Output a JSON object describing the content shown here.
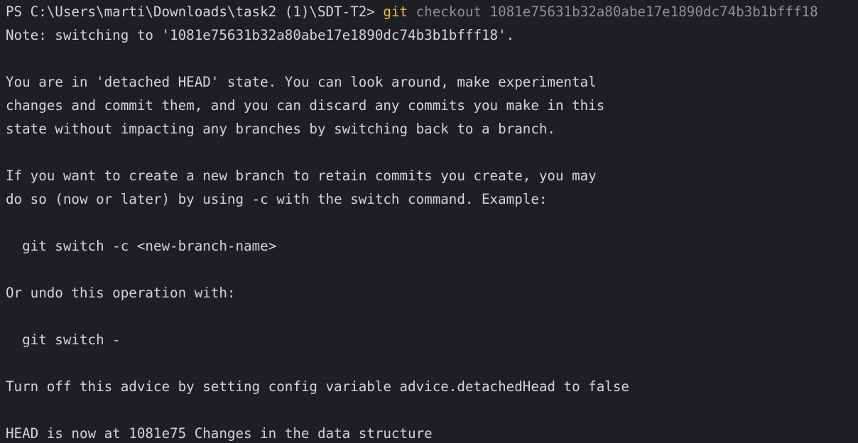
{
  "terminal": {
    "prompt": "PS C:\\Users\\marti\\Downloads\\task2 (1)\\SDT-T2> ",
    "command": "git",
    "args": " checkout 1081e75631b32a80abe17e1890dc74b3b1bfff18",
    "output": [
      "Note: switching to '1081e75631b32a80abe17e1890dc74b3b1bfff18'.",
      "",
      "You are in 'detached HEAD' state. You can look around, make experimental",
      "changes and commit them, and you can discard any commits you make in this",
      "state without impacting any branches by switching back to a branch.",
      "",
      "If you want to create a new branch to retain commits you create, you may",
      "do so (now or later) by using -c with the switch command. Example:",
      "",
      "  git switch -c <new-branch-name>",
      "",
      "Or undo this operation with:",
      "",
      "  git switch -",
      "",
      "Turn off this advice by setting config variable advice.detachedHead to false",
      "",
      "HEAD is now at 1081e75 Changes in the data structure"
    ],
    "colors": {
      "background": "#1e1f22",
      "text": "#d4d5d8",
      "command": "#e8c04f",
      "args": "#8d8f93"
    }
  }
}
